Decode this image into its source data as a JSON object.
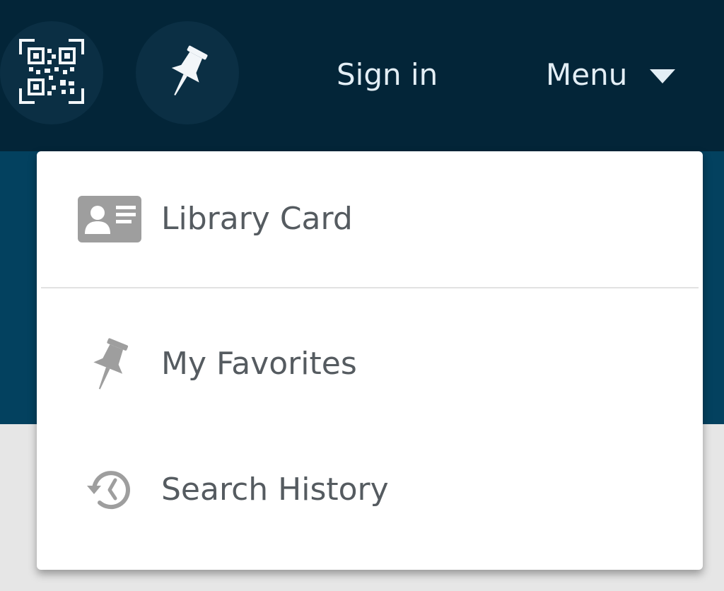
{
  "header": {
    "sign_in_label": "Sign in",
    "menu_label": "Menu",
    "icons": {
      "qr": "qr-code-icon",
      "pin": "pushpin-icon",
      "caret": "caret-down-icon"
    }
  },
  "menu": {
    "items": [
      {
        "label": "Library Card",
        "icon": "id-card-icon"
      },
      {
        "label": "My Favorites",
        "icon": "pushpin-icon"
      },
      {
        "label": "Search History",
        "icon": "history-icon"
      }
    ]
  },
  "colors": {
    "header_bg": "#032538",
    "band_bg": "#03415f",
    "header_text": "#e3eef5",
    "menu_text": "#555b60",
    "menu_icon": "#9e9e9e"
  }
}
